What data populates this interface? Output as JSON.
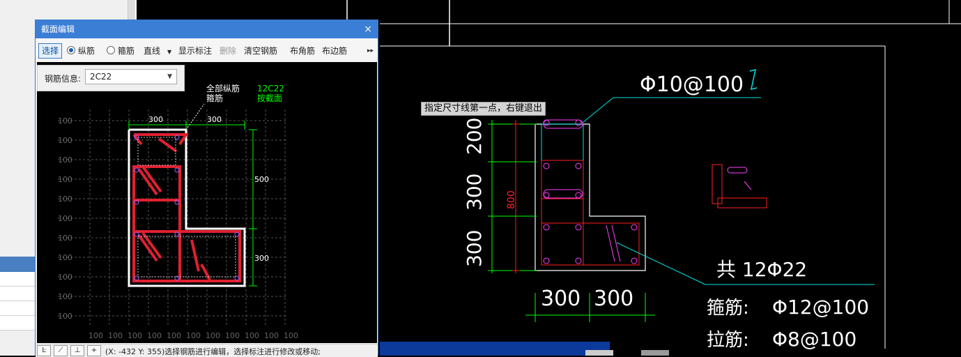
{
  "dialog": {
    "title": "截面编辑",
    "close": "×",
    "toolbar": {
      "select": "选择",
      "longitudinal": "纵筋",
      "stirrup": "箍筋",
      "line_mode": "直线",
      "show_dim": "显示标注",
      "delete": "删除",
      "clear_rebar": "清空钢筋",
      "corner_rebar": "布角筋",
      "edge_rebar": "布边筋",
      "more": "▸▸"
    },
    "rebar_info": {
      "label": "钢筋信息:",
      "value": "2C22"
    },
    "canvas": {
      "grid_label": "100",
      "dim_top_left": "300",
      "dim_top_right": "300",
      "dim_right_top": "500",
      "dim_right_bottom": "300",
      "ann_all_long_1": "全部纵筋",
      "ann_all_long_2": "箍筋",
      "ann_spec_1": "12C22",
      "ann_spec_2": "按截面"
    },
    "status": {
      "text": "(X: -432 Y: 355)选择钢筋进行编辑，选择标注进行修改或移动;"
    }
  },
  "cad": {
    "tooltip": "指定尺寸线第一点，右键退出",
    "top_rebar": "Φ10@100",
    "dim_left_1": "200",
    "dim_left_2": "300",
    "dim_left_3": "300",
    "dim_total": "800",
    "total_rebar": "共 12Φ22",
    "dim_bottom_1": "300",
    "dim_bottom_2": "300",
    "stirrup_label": "箍筋:",
    "stirrup_value": "Φ12@100",
    "tie_label": "拉筋:",
    "tie_value": "Φ8@100"
  },
  "colors": {
    "green": "#00ff00",
    "red": "#ff2020",
    "cyan": "#00e5e5",
    "magenta": "#ff40ff",
    "title_blue": "#3b7ed6"
  }
}
